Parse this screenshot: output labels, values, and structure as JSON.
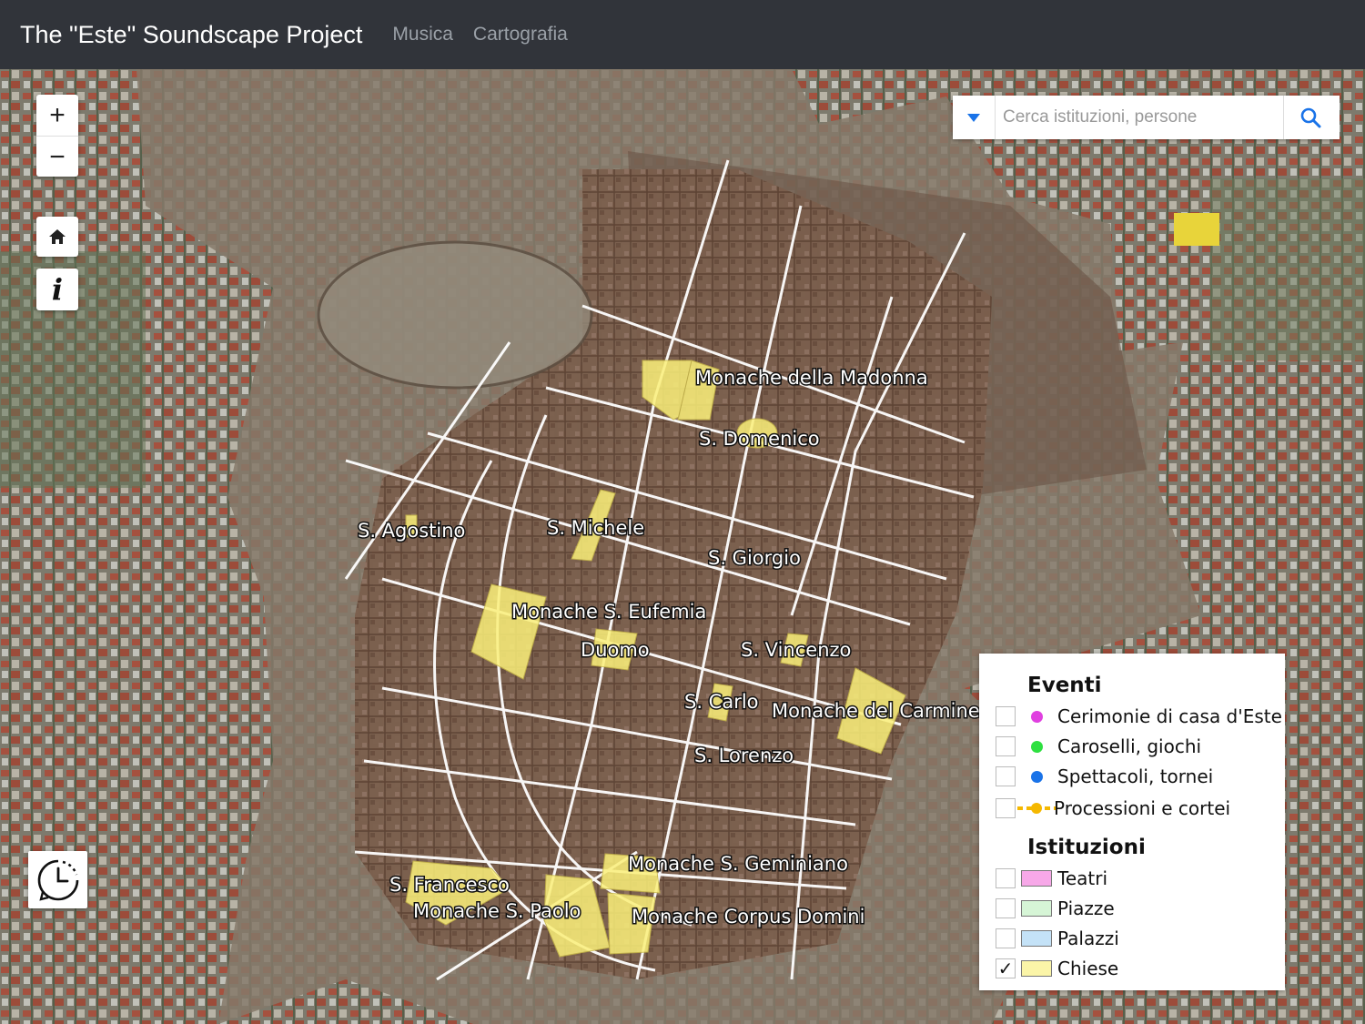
{
  "navbar": {
    "brand": "The \"Este\" Soundscape Project",
    "links": [
      "Musica",
      "Cartografia"
    ]
  },
  "map_controls": {
    "zoom_in": "+",
    "zoom_out": "−",
    "home_icon": "home-icon",
    "info_icon": "info-icon",
    "timeline_icon": "clock-history-icon"
  },
  "search": {
    "placeholder": "Cerca istituzioni, persone",
    "value": ""
  },
  "map_labels": [
    "Monache della Madonna",
    "S. Domenico",
    "S. Agostino",
    "S. Michele",
    "S. Giorgio",
    "Monache S. Eufemia",
    "Duomo",
    "S. Vincenzo",
    "S. Carlo",
    "Monache del Carmine",
    "S. Lorenzo",
    "Monache S. Geminiano",
    "S. Francesco",
    "Monache S. Paolo",
    "Monache Corpus Domini"
  ],
  "legend": {
    "eventi_title": "Eventi",
    "eventi": [
      {
        "label": "Cerimonie di casa d'Este",
        "color": "#e040e0",
        "checked": false
      },
      {
        "label": "Caroselli, giochi",
        "color": "#2ee040",
        "checked": false
      },
      {
        "label": "Spettacoli, tornei",
        "color": "#1a73e8",
        "checked": false
      },
      {
        "label": "Processioni e cortei",
        "color": "#f5b800",
        "checked": false
      }
    ],
    "istituzioni_title": "Istituzioni",
    "istituzioni": [
      {
        "label": "Teatri",
        "color": "#f7a8e8",
        "checked": false
      },
      {
        "label": "Piazze",
        "color": "#d6f5d6",
        "checked": false
      },
      {
        "label": "Palazzi",
        "color": "#c4e2f7",
        "checked": false
      },
      {
        "label": "Chiese",
        "color": "#fbf5a8",
        "checked": true
      }
    ],
    "check_mark": "✓"
  }
}
